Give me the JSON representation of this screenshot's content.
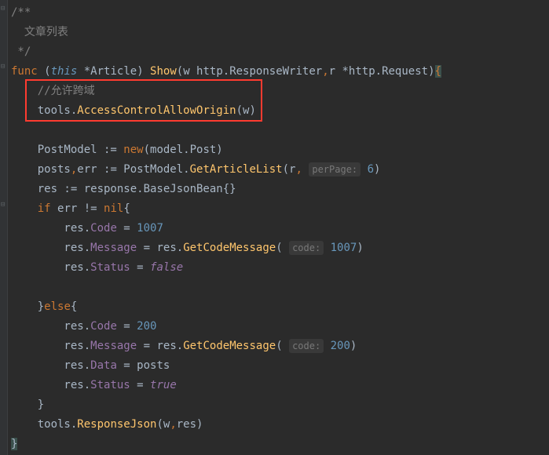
{
  "gutter": {
    "fold1": "⊟",
    "fold2": "⊟",
    "fold3": "⊟"
  },
  "code": {
    "l1": {
      "a": "/**"
    },
    "l2": {
      "a": "  文章列表"
    },
    "l3": {
      "a": " */"
    },
    "l4": {
      "a": "func ",
      "b": "(",
      "c": "this",
      "d": " *",
      "e": "Article",
      "f": ") ",
      "g": "Show",
      "h": "(w http.ResponseWriter",
      "i": ",",
      "j": "r *http.Request)",
      "k": "{"
    },
    "l5": {
      "a": "    //允许跨域"
    },
    "l6": {
      "a": "    tools.",
      "b": "AccessControlAllowOrigin",
      "c": "(w)"
    },
    "l7": {
      "a": ""
    },
    "l8": {
      "a": "    PostModel := ",
      "b": "new",
      "c": "(model.Post)"
    },
    "l9": {
      "a": "    posts",
      "b": ",",
      "c": "err := PostModel.",
      "d": "GetArticleList",
      "e": "(r",
      "f": ",",
      "g": " ",
      "h": "perPage:",
      "i": " ",
      "j": "6",
      "k": ")"
    },
    "l10": {
      "a": "    res := response.BaseJsonBean{}"
    },
    "l11": {
      "a": "    ",
      "b": "if ",
      "c": "err != ",
      "d": "nil",
      "e": "{"
    },
    "l12": {
      "a": "        res.",
      "b": "Code",
      "c": " = ",
      "d": "1007"
    },
    "l13": {
      "a": "        res.",
      "b": "Message",
      "c": " = res.",
      "d": "GetCodeMessage",
      "e": "( ",
      "f": "code:",
      "g": " ",
      "h": "1007",
      "i": ")"
    },
    "l14": {
      "a": "        res.",
      "b": "Status",
      "c": " = ",
      "d": "false"
    },
    "l15": {
      "a": ""
    },
    "l16": {
      "a": "    }",
      "b": "else",
      "c": "{"
    },
    "l17": {
      "a": "        res.",
      "b": "Code",
      "c": " = ",
      "d": "200"
    },
    "l18": {
      "a": "        res.",
      "b": "Message",
      "c": " = res.",
      "d": "GetCodeMessage",
      "e": "( ",
      "f": "code:",
      "g": " ",
      "h": "200",
      "i": ")"
    },
    "l19": {
      "a": "        res.",
      "b": "Data",
      "c": " = posts"
    },
    "l20": {
      "a": "        res.",
      "b": "Status",
      "c": " = ",
      "d": "true"
    },
    "l21": {
      "a": "    }"
    },
    "l22": {
      "a": "    tools.",
      "b": "ResponseJson",
      "c": "(w",
      "d": ",",
      "e": "res)"
    },
    "l23": {
      "a": "}"
    }
  }
}
